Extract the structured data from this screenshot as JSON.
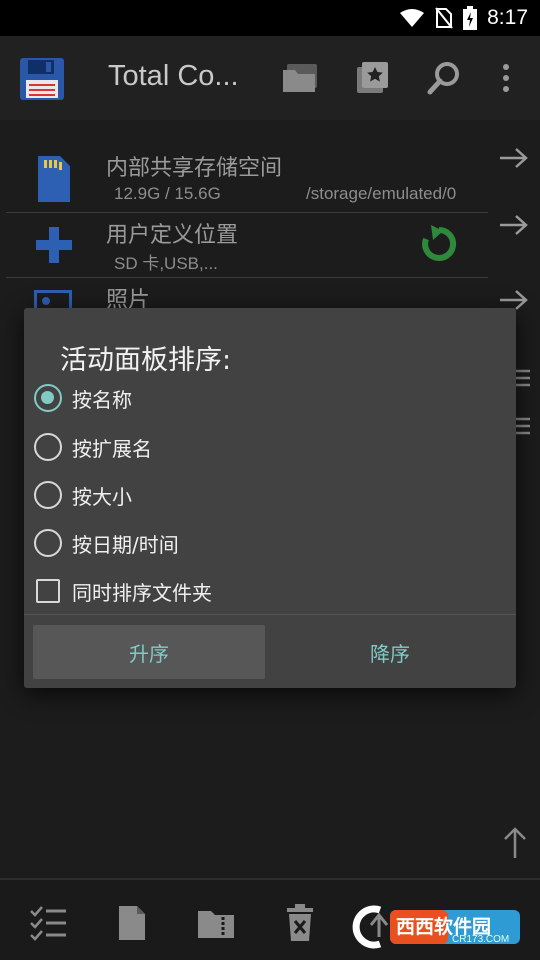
{
  "status_bar": {
    "time": "8:17",
    "icons": [
      "wifi-icon",
      "no-sim-icon",
      "battery-charging-icon"
    ]
  },
  "app_bar": {
    "title": "Total Co...",
    "actions": [
      "folder-tabs-icon",
      "bookmarks-icon",
      "search-icon",
      "overflow-menu-icon"
    ]
  },
  "list": {
    "items": [
      {
        "name": "内部共享存储空间",
        "size": "12.9G / 15.6G",
        "path": "/storage/emulated/0",
        "icon": "sd-card-icon"
      },
      {
        "name": "用户定义位置",
        "sub": "SD 卡,USB,...",
        "icon": "plus-icon",
        "action_icon": "refresh-icon"
      },
      {
        "name": "照片",
        "icon": "photo-icon"
      }
    ]
  },
  "dialog": {
    "title": "活动面板排序:",
    "options": [
      {
        "label": "按名称",
        "selected": true
      },
      {
        "label": "按扩展名",
        "selected": false
      },
      {
        "label": "按大小",
        "selected": false
      },
      {
        "label": "按日期/时间",
        "selected": false
      }
    ],
    "checkbox": {
      "label": "同时排序文件夹",
      "checked": false
    },
    "buttons": {
      "ascending": "升序",
      "descending": "降序"
    }
  },
  "toolbar": {
    "actions": [
      "select-list-icon",
      "new-file-icon",
      "archive-folder-icon",
      "delete-icon",
      "copy-move-icon",
      "more-folders-icon"
    ]
  },
  "watermark": {
    "text": "西西软件园",
    "sub": "CR173.COM"
  },
  "colors": {
    "accent": "#80cbc4",
    "dialog_bg": "#424242",
    "appbar_bg": "#212121",
    "panel_bg": "#1c1c1c"
  }
}
